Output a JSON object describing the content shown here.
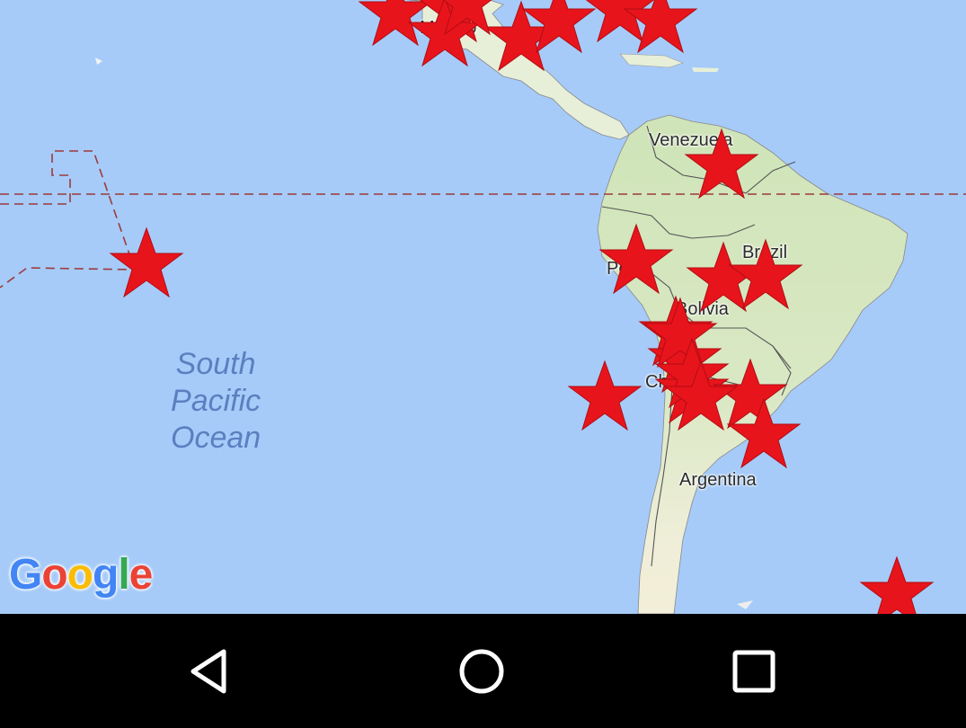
{
  "map": {
    "labels": {
      "mexico": "México",
      "venezuela": "Venezuela",
      "peru": "Peru",
      "brazil": "Brazil",
      "bolivia": "Bolivia",
      "chile": "Chile",
      "argentina": "Argentina"
    },
    "ocean_label": {
      "line1": "South",
      "line2": "Pacific",
      "line3": "Ocean"
    },
    "marker_icon": "red-star-icon",
    "marker_count": 23,
    "logo": {
      "text": "Google",
      "colors": [
        "#4285F4",
        "#EA4335",
        "#FBBC05",
        "#4285F4",
        "#34A853",
        "#EA4335"
      ]
    },
    "colors": {
      "ocean": "#a6cbf9",
      "land": "#e9eedd",
      "land_green": "#cfe4b8",
      "marker": "#e8141c",
      "border": "#555555",
      "boundary_dash": "#9c3b3b"
    }
  },
  "navbar": {
    "back": "back-icon",
    "home": "home-icon",
    "recents": "recents-icon"
  }
}
